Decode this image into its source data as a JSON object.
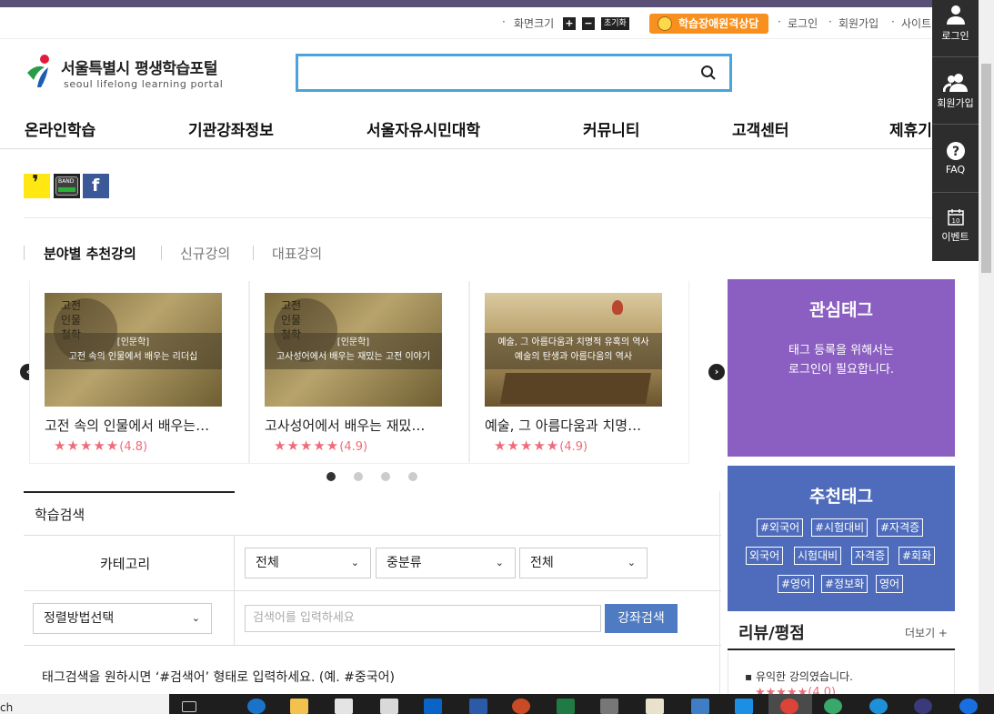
{
  "util": {
    "font_size_label": "화면크기",
    "plus": "+",
    "minus": "−",
    "reset": "초기화",
    "consult": "학습장애원격상담",
    "login": "로그인",
    "join": "회원가입",
    "sitemap": "사이트"
  },
  "sidebar": {
    "items": [
      {
        "label": "로그인",
        "icon": "person-icon"
      },
      {
        "label": "회원가입",
        "icon": "people-icon"
      },
      {
        "label": "FAQ",
        "icon": "question-icon"
      },
      {
        "label": "이벤트",
        "icon": "calendar-icon",
        "calendar_day": "10"
      }
    ]
  },
  "logo": {
    "title": "서울특별시 평생학습포털",
    "subtitle": "seoul lifelong learning portal"
  },
  "search": {
    "value": ""
  },
  "nav": {
    "items": [
      "온라인학습",
      "기관강좌정보",
      "서울자유시민대학",
      "커뮤니티",
      "고객센터",
      "제휴기"
    ]
  },
  "sns": {
    "kakao_glyph": "❜",
    "band_label": "BAND",
    "facebook_glyph": "f"
  },
  "tabs": [
    "분야별 추천강의",
    "신규강의",
    "대표강의"
  ],
  "cards": [
    {
      "category": "[인문학]",
      "caption": "고전 속의 인물에서 배우는 리더십",
      "overlay": "고전\n인물\n철학",
      "title": "고전 속의 인물에서 배우는…",
      "rating": "(4.8)"
    },
    {
      "category": "[인문학]",
      "caption": "고사성어에서 배우는 재밌는 고전 이야기",
      "overlay": "고전\n인물\n철학",
      "title": "고사성어에서 배우는 재밌…",
      "rating": "(4.9)"
    },
    {
      "category": "예술, 그 아름다움과 치명적 유혹의 역사",
      "caption": "예술의 탄생과 아름다움의 역사",
      "overlay": "",
      "title": "예술, 그 아름다움과 치명…",
      "rating": "(4.9)"
    }
  ],
  "stars": "★★★★★",
  "carousel": {
    "prev": "‹",
    "next": "›",
    "dots": 4,
    "active_dot": 1
  },
  "learn": {
    "title": "학습검색",
    "category_label": "카테고리",
    "select1": "전체",
    "select2": "중분류",
    "select3": "전체",
    "sort": "정렬방법선택",
    "keyword_placeholder": "검색어를 입력하세요",
    "search_button": "강좌검색",
    "hint": "태그검색을 원하시면 ‘#검색어’ 형태로 입력하세요. (예. #중국어)"
  },
  "interest_tags": {
    "title": "관심태그",
    "message_line1": "태그 등록을 위해서는",
    "message_line2": "로그인이 필요합니다."
  },
  "recommend_tags": {
    "title": "추천태그",
    "tags": [
      "#외국어",
      "#시험대비",
      "#자격증",
      "외국어",
      "시험대비",
      "자격증",
      "#회화",
      "#영어",
      "#정보화",
      "영어"
    ]
  },
  "review": {
    "title": "리뷰/평점",
    "more": "더보기 +",
    "item": "유익한 강의였습니다.",
    "rating": "(4.0)"
  },
  "taskbar": {
    "left_text": "ch"
  },
  "colors": {
    "accent_orange": "#f7901e",
    "search_border": "#4aa3df",
    "interest_purple": "#8b5fc1",
    "recommend_blue": "#4e6cbb",
    "star_pink": "#f06b7a",
    "button_blue": "#4e7bc1"
  }
}
